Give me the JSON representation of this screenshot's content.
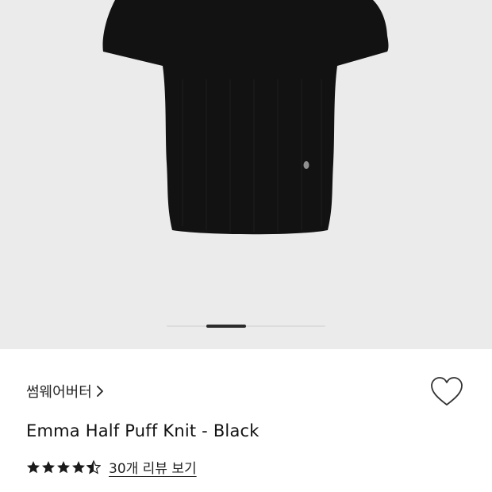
{
  "product": {
    "brand": "썸웨어버터",
    "name": "Emma Half Puff Knit - Black",
    "rating": 4.5,
    "rating_max": 5,
    "review_link": "30개 리뷰 보기"
  },
  "carousel": {
    "active_fraction_start": 0.25,
    "active_fraction_width": 0.25
  },
  "colors": {
    "image_bg": "#ebebeb",
    "garment": "#121212",
    "star": "#1a1a1a",
    "text": "#111111"
  },
  "icons": {
    "brand_chevron": "chevron-right-icon",
    "wishlist": "heart-outline-icon",
    "star": "star-icon"
  }
}
